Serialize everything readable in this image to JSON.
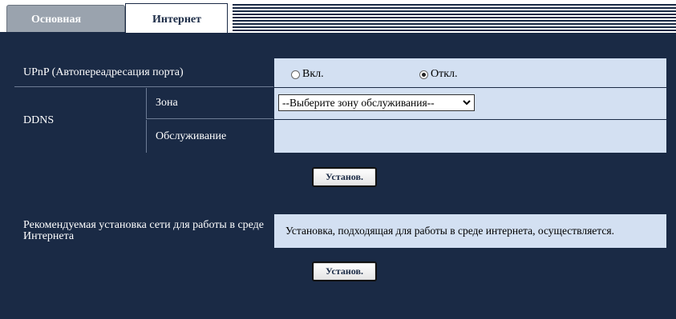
{
  "tabs": [
    {
      "label": "Основная",
      "active": false
    },
    {
      "label": "Интернет",
      "active": true
    }
  ],
  "upnp": {
    "label": "UPnP (Автопереадресация порта)",
    "options": [
      {
        "label": "Вкл.",
        "checked": false
      },
      {
        "label": "Откл.",
        "checked": true
      }
    ]
  },
  "ddns": {
    "label": "DDNS",
    "zone_label": "Зона",
    "zone_value": "--Выберите зону обслуживания--",
    "service_label": "Обслуживание"
  },
  "apply_button_1": "Установ.",
  "recommended": {
    "label": "Рекомендуемая установка сети для работы в среде Интернета",
    "value": "Установка, подходящая для работы в среде интернета, осуществляется."
  },
  "apply_button_2": "Установ.",
  "colors": {
    "header_bg": "#1a2a45",
    "value_bg": "#d3e0f2"
  }
}
